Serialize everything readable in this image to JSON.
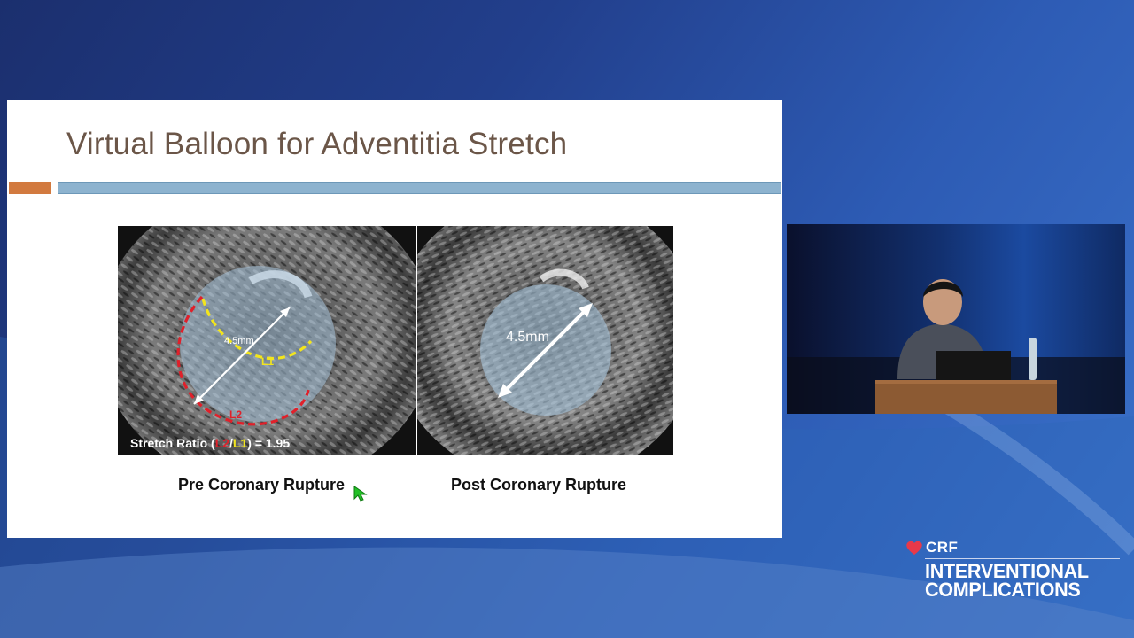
{
  "slide": {
    "title": "Virtual Balloon for Adventitia Stretch",
    "pre_panel": {
      "diameter_label": "4.5mm",
      "l1_label": "L1",
      "l2_label": "L2",
      "stretch_prefix": "Stretch Ratio (",
      "stretch_l2": "L2",
      "stretch_sep": "/",
      "stretch_l1": "L1",
      "stretch_suffix": ") = 1.95"
    },
    "post_panel": {
      "diameter_label": "4.5mm"
    },
    "caption_pre": "Pre Coronary Rupture",
    "caption_post": "Post Coronary Rupture"
  },
  "branding": {
    "crf": "CRF",
    "line1": "INTERVENTIONAL",
    "line2": "COMPLICATIONS"
  },
  "colors": {
    "title_text": "#6b5648",
    "accent_bar": "#d27a3f",
    "title_bar": "#8db3cf",
    "l1_dash": "#f2e51d",
    "l2_dash": "#e0202a",
    "crf_heart": "#e8394a",
    "cursor": "#22c026"
  }
}
